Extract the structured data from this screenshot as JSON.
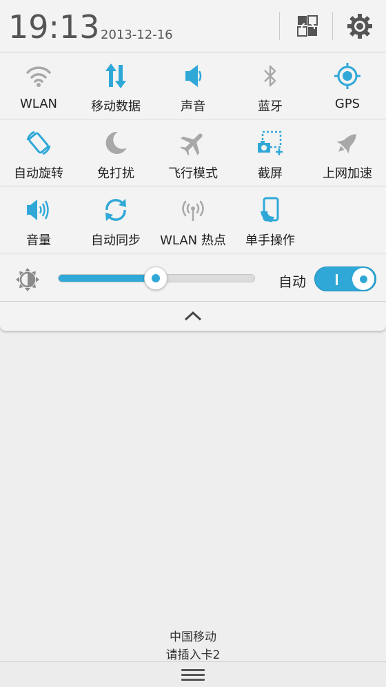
{
  "status": {
    "time": "19:13",
    "date": "2013-12-16"
  },
  "header_icons": [
    "switch-icon",
    "gear-icon"
  ],
  "colors": {
    "accent": "#2fa8d8",
    "inactive_icon": "#a5a5a5",
    "text": "#222222"
  },
  "toggles": {
    "wlan": {
      "label": "WLAN",
      "icon": "wifi-icon",
      "active": false
    },
    "mobile_data": {
      "label": "移动数据",
      "icon": "mobile-data-icon",
      "active": true
    },
    "sound": {
      "label": "声音",
      "icon": "speaker-icon",
      "active": true
    },
    "bluetooth": {
      "label": "蓝牙",
      "icon": "bluetooth-icon",
      "active": false
    },
    "gps": {
      "label": "GPS",
      "icon": "gps-icon",
      "active": true
    },
    "auto_rotate": {
      "label": "自动旋转",
      "icon": "rotate-icon",
      "active": true
    },
    "do_not_disturb": {
      "label": "免打扰",
      "icon": "moon-icon",
      "active": false
    },
    "airplane": {
      "label": "飞行模式",
      "icon": "airplane-icon",
      "active": false
    },
    "screenshot": {
      "label": "截屏",
      "icon": "screenshot-icon",
      "active": true
    },
    "boost": {
      "label": "上网加速",
      "icon": "rocket-icon",
      "active": false
    },
    "volume": {
      "label": "音量",
      "icon": "volume-icon",
      "active": true
    },
    "auto_sync": {
      "label": "自动同步",
      "icon": "sync-icon",
      "active": true
    },
    "hotspot": {
      "label": "WLAN 热点",
      "icon": "hotspot-icon",
      "active": false
    },
    "one_hand": {
      "label": "单手操作",
      "icon": "one-hand-icon",
      "active": true
    }
  },
  "brightness": {
    "level": 0.5,
    "auto_label": "自动",
    "auto_enabled": true
  },
  "carrier": {
    "line1": "中国移动",
    "line2": "请插入卡2"
  }
}
